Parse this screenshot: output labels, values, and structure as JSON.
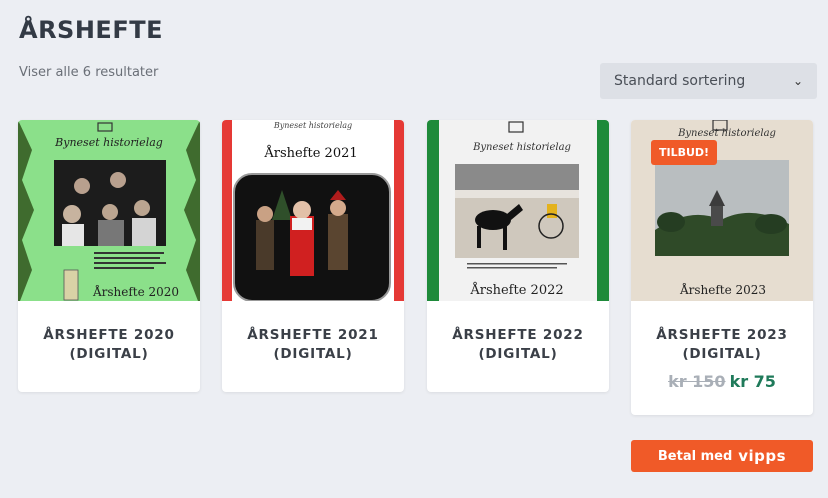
{
  "header": {
    "title": "ÅRSHEFTE"
  },
  "results": {
    "count_text": "Viser alle 6 resultater"
  },
  "sort": {
    "selected": "Standard sortering"
  },
  "products": [
    {
      "name": "ÅRSHEFTE 2020 (DIGITAL)",
      "cover_title": "Årshefte 2020",
      "cover_heading": "Byneset historielag"
    },
    {
      "name": "ÅRSHEFTE 2021 (DIGITAL)",
      "cover_title": "Årshefte 2021",
      "cover_heading": "Byneset historielag"
    },
    {
      "name": "ÅRSHEFTE 2022 (DIGITAL)",
      "cover_title": "Årshefte 2022",
      "cover_heading": "Byneset historielag"
    },
    {
      "name": "ÅRSHEFTE 2023 (DIGITAL)",
      "cover_title": "Årshefte 2023",
      "cover_heading": "Byneset historielag",
      "badge": "TILBUD!",
      "old_price": "kr 150",
      "new_price": "kr 75"
    }
  ],
  "checkout": {
    "label": "Betal med",
    "brand": "vipps"
  },
  "colors": {
    "accent": "#f05a28",
    "price_green": "#1f7a5a",
    "background": "#eceef3"
  }
}
